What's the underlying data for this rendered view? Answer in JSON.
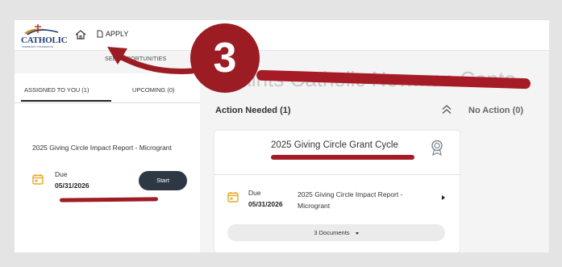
{
  "header": {
    "logo_text": "CATHOLIC",
    "logo_subtext": "COMMUNITY FOUNDATION",
    "apply_label": "APPLY",
    "see_opportunities": "SEE OPPORTUNITIES"
  },
  "left_panel": {
    "tab_assigned": "ASSIGNED TO YOU (1)",
    "tab_upcoming": "UPCOMING (0)",
    "item": {
      "title": "2025 Giving Circle Impact Report - Microgrant",
      "due_label": "Due",
      "due_date": "05/31/2026",
      "start_label": "Start"
    }
  },
  "main": {
    "heading_partial": "Saints Catholic Newman Cente",
    "action_needed": "Action Needed (1)",
    "no_action": "No Action (0)",
    "card": {
      "title": "2025 Giving Circle Grant Cycle",
      "due_label": "Due",
      "due_date": "05/31/2026",
      "task_title": "2025 Giving Circle Impact Report - Microgrant",
      "documents_label": "3 Documents"
    }
  },
  "annotation": {
    "step_number": "3",
    "color": "#9b1c22"
  },
  "icons": [
    "logo-icon",
    "home-icon",
    "document-icon",
    "calendar-icon",
    "chevron-up-icon",
    "award-icon",
    "caret-right-icon",
    "caret-down-icon"
  ]
}
